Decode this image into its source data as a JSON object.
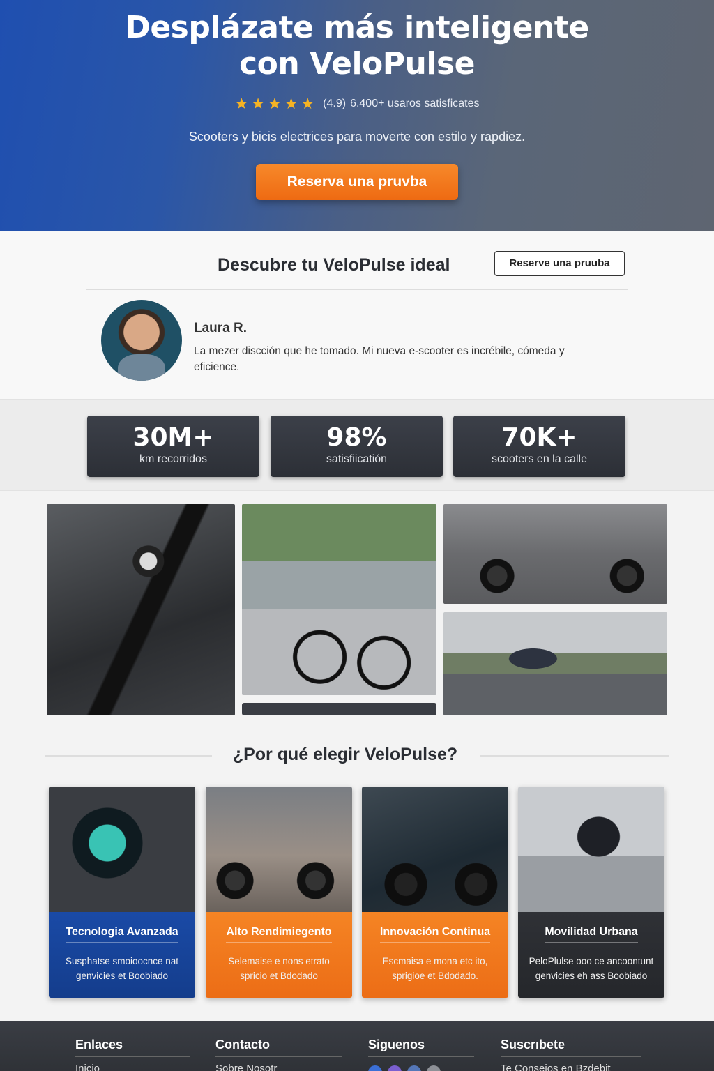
{
  "hero": {
    "title_line1": "Desplázate más inteligente",
    "title_line2": "con VeloPulse",
    "rating_value": "(4.9)",
    "rating_text": "6.400+ usaros satisficates",
    "stars": 5,
    "subtitle": "Scooters y bicis electrices para moverte con estilo y rapdiez.",
    "cta_label": "Reserva una pruvba"
  },
  "discover": {
    "title": "Descubre tu VeloPulse ideal",
    "button_label": "Reserve una pruuba",
    "testimonial": {
      "name": "Laura R.",
      "text": "La mezer discción que he tomado. Mi nueva e-scooter es incrébile, cómeda y eficience."
    }
  },
  "stats": [
    {
      "value": "30M+",
      "label": "km recorridos"
    },
    {
      "value": "98%",
      "label": "satisfiicatión"
    },
    {
      "value": "70K+",
      "label": "scooters en la calle"
    }
  ],
  "why": {
    "title": "¿Por qué elegir VeloPulse?",
    "cards": [
      {
        "title": "Tecnologia Avanzada",
        "text": "Susphatse smoioocnce nat genvicies et Boobiado",
        "color": "#1a4aa6"
      },
      {
        "title": "Alto Rendimiegento",
        "text": "Selemaise e nons etrato spricio et Bdodado",
        "color": "#f58424"
      },
      {
        "title": "Innovación Continua",
        "text": "Escmaisa e mona etc ito, sprigioe et Bdodado.",
        "color": "#f58424"
      },
      {
        "title": "Movilidad Urbana",
        "text": "PeloPlulse ooo ce ancoontunt genvicies eh ass Boobiado",
        "color": "#2f3136"
      }
    ]
  },
  "footer": {
    "col1_heading": "Enlaces",
    "col1_link": "Inicio",
    "col2_heading": "Contacto",
    "col2_link": "Sobre Nosotr",
    "col3_heading": "Siguenos",
    "col4_heading": "Suscrıbete",
    "col4_link": "Te Consejos en Bzdebit"
  }
}
